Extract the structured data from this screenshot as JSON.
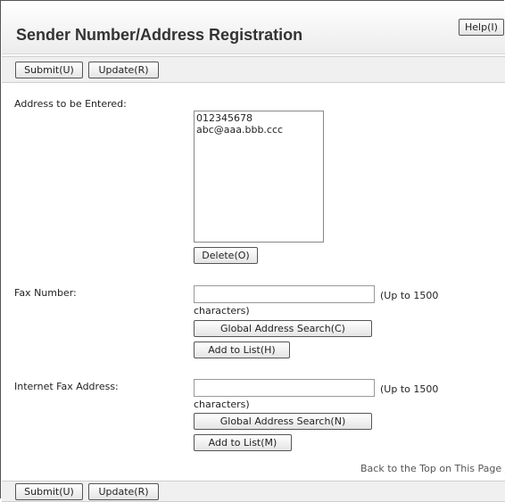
{
  "page": {
    "title": "Sender Number/Address Registration",
    "help_label": "Help(I)"
  },
  "toolbar_top": {
    "submit_label": "Submit(U)",
    "update_label": "Update(R)"
  },
  "toolbar_bottom": {
    "submit_label": "Submit(U)",
    "update_label": "Update(R)"
  },
  "address_section": {
    "label": "Address to be Entered:",
    "items": [
      "012345678",
      "abc@aaa.bbb.ccc"
    ],
    "delete_label": "Delete(O)"
  },
  "fax_section": {
    "label": "Fax Number:",
    "value": "",
    "hint_part1": "(Up to 1500",
    "hint_part2": "characters)",
    "search_label": "Global Address Search(C)",
    "add_label": "Add to List(H)"
  },
  "ifax_section": {
    "label": "Internet Fax Address:",
    "value": "",
    "hint_part1": "(Up to 1500",
    "hint_part2": "characters)",
    "search_label": "Global Address Search(N)",
    "add_label": "Add to List(M)"
  },
  "footer": {
    "back_to_top": "Back to the Top on This Page"
  }
}
